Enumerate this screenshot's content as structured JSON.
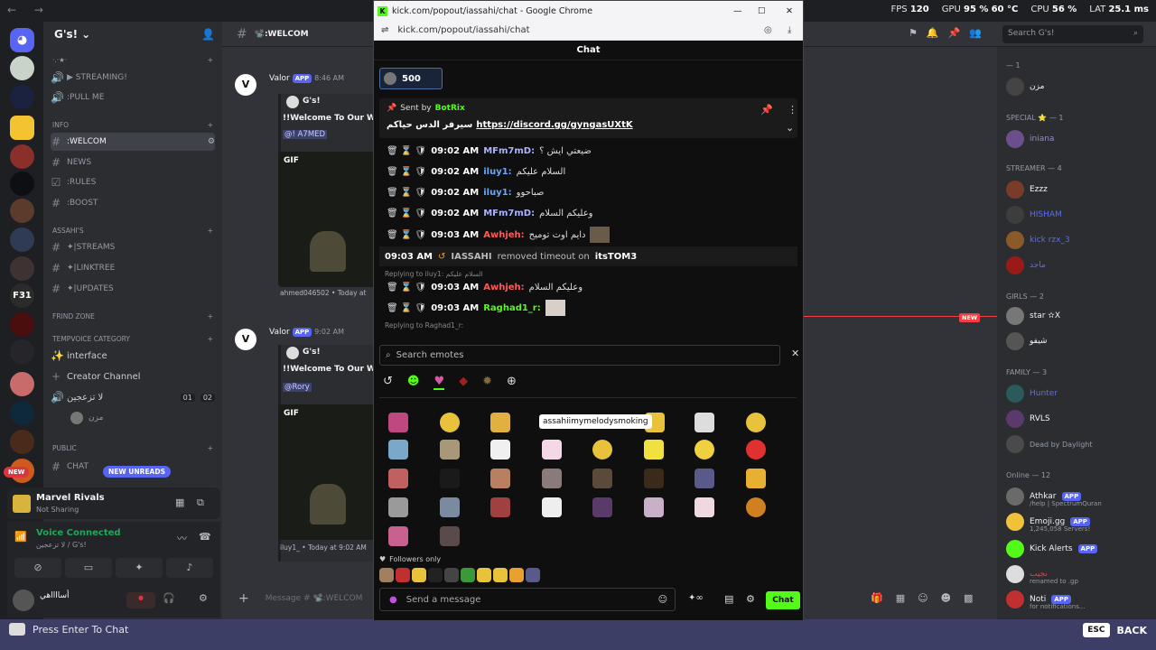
{
  "perf": {
    "fps_label": "FPS",
    "fps": "120",
    "gpu_label": "GPU",
    "gpu": "95 %",
    "gpu_temp": "60 °C",
    "cpu_label": "CPU",
    "cpu": "56 %",
    "lat_label": "LAT",
    "lat": "25.1 ms"
  },
  "discord": {
    "server_name": "G's!",
    "channel_title": "📽️:WELCOM",
    "search_placeholder": "Search G's!",
    "channels": [
      {
        "label": "▶ STREAMING!",
        "type": "voice"
      },
      {
        "label": ":PULL ME",
        "type": "voice"
      },
      {
        "label": ":WELCOM",
        "type": "text"
      },
      {
        "label": "NEWS",
        "type": "text"
      },
      {
        "label": ":RULES",
        "type": "text"
      },
      {
        "label": ":BOOST",
        "type": "text"
      },
      {
        "label": "✦|STREAMS",
        "type": "text"
      },
      {
        "label": "✦|LINKTREE",
        "type": "text"
      },
      {
        "label": "✦|UPDATES",
        "type": "text"
      },
      {
        "label": "interface",
        "type": "voice"
      },
      {
        "label": "Creator Channel",
        "type": "voice"
      },
      {
        "label": "لا تزعجين",
        "type": "voice"
      },
      {
        "label": "CHAT",
        "type": "text"
      }
    ],
    "categories": [
      "INFO",
      "ASSAHI'S",
      "FRIND ZONE",
      "TEMPVOICE CATEGORY",
      "PUBLIC"
    ],
    "voice_user": "مزن",
    "voice_counts": [
      "01",
      "02"
    ],
    "new_unreads": "NEW UNREADS",
    "new_badge": "NEW",
    "activity": {
      "title": "Marvel Rivals",
      "status": "Not Sharing"
    },
    "voice": {
      "title": "Voice Connected",
      "sub": "لا تزعجين / G's!"
    },
    "user": {
      "name": "أسااااهي"
    },
    "messages": [
      {
        "author": "Valor",
        "tag": "APP",
        "time": "8:46 AM",
        "server": "G's!",
        "text": "!!Welcome To Our Worl",
        "mention": "@! A7MED",
        "gif_tag": "GIF",
        "poster": "ahmed046502 • Today at"
      },
      {
        "author": "Valor",
        "tag": "APP",
        "time": "9:02 AM",
        "server": "G's!",
        "text": "!!Welcome To Our Worl",
        "mention": "@Rory",
        "gif_tag": "GIF",
        "poster": "iluy1_ • Today at 9:02 AM"
      }
    ],
    "message_placeholder": "Message # 📽️:WELCOM",
    "members": {
      "cats": [
        "— 1",
        "SPECIAL ⭐ — 1",
        "STREAMER — 4",
        "GIRLS — 2",
        "FAMILY — 3",
        "Online — 12"
      ],
      "list": [
        "مزن",
        "iniana",
        "Ezzz",
        "HISHAM",
        "kick rzx_3",
        "ماجد",
        "star ✫X",
        "شيفو",
        "Hunter",
        "RVLS",
        "Dead by Daylight",
        "Athkar",
        "Emoji.gg",
        "Kick Alerts",
        "نجيب",
        "Noti"
      ],
      "subs": [
        "/help | SpectrumQuran",
        "1,245,058 Servers!",
        "renamed to .gp",
        "for notifications..."
      ],
      "app_tag": "APP"
    }
  },
  "popup": {
    "title": "kick.com/popout/iassahi/chat - Google Chrome",
    "url": "kick.com/popout/iassahi/chat",
    "chat_header": "Chat",
    "gift_count": "500",
    "pinned": {
      "prefix": "Sent by",
      "bot": "BotRix",
      "text": "سيرفر الدس حياكم",
      "link": "https://discord.gg/gyngasUXtK"
    },
    "messages": [
      {
        "time": "09:02 AM",
        "user": "MFm7mD:",
        "text": "ضيعتي ايش ؟",
        "color": "#a8b4ff"
      },
      {
        "time": "09:02 AM",
        "user": "iluy1:",
        "text": "السلام عليكم",
        "color": "#6aa8ff"
      },
      {
        "time": "09:02 AM",
        "user": "iluy1:",
        "text": "صباحوو",
        "color": "#6aa8ff"
      },
      {
        "time": "09:02 AM",
        "user": "MFm7mD:",
        "text": "وعليكم السلام",
        "color": "#a8b4ff"
      },
      {
        "time": "09:03 AM",
        "user": "Awhjeh:",
        "text": "دايم اوت توميح",
        "color": "#ff5a5a"
      }
    ],
    "mod_action": {
      "time": "09:03 AM",
      "mod": "IASSAHI",
      "action": "removed timeout on",
      "target": "itsTOM3"
    },
    "reply1": "Replying to iluy1: السلام عليكم",
    "reply_msgs": [
      {
        "time": "09:03 AM",
        "user": "Awhjeh:",
        "text": "وعليكم السلام",
        "color": "#ff5a5a"
      },
      {
        "time": "09:03 AM",
        "user": "Raghad1_r:",
        "text": "",
        "color": "#53fc18"
      }
    ],
    "reply2": "Replying to Raghad1_r:",
    "emote_search": "Search emotes",
    "tooltip": "assahiimymelodysmoking",
    "followers_only": "Followers only",
    "send_placeholder": "Send a message",
    "chat_button": "Chat"
  },
  "taskbar": {
    "press_enter": "Press Enter To Chat",
    "esc": "ESC",
    "back": "BACK"
  }
}
